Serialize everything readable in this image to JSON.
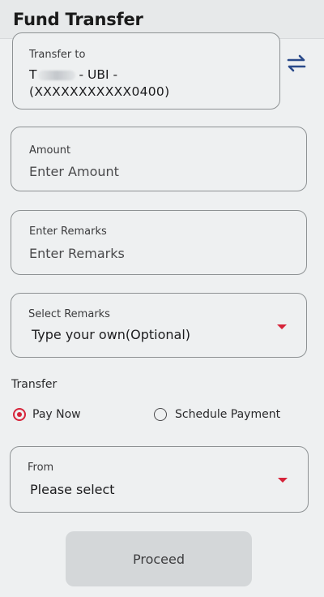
{
  "header": {
    "title": "Fund Transfer"
  },
  "transfer_to": {
    "label": "Transfer to",
    "name_initial": "T",
    "bank_suffix": "- UBI -",
    "account_masked": "(XXXXXXXXXXX0400)",
    "swap_icon": "swap-arrows-icon"
  },
  "amount": {
    "label": "Amount",
    "placeholder": "Enter Amount"
  },
  "remarks": {
    "label": "Enter Remarks",
    "placeholder": "Enter Remarks"
  },
  "select_remarks": {
    "label": "Select Remarks",
    "value": "Type your own(Optional)",
    "icon": "dropdown-arrow-icon"
  },
  "transfer_section": {
    "label": "Transfer",
    "options": [
      {
        "label": "Pay Now",
        "selected": true
      },
      {
        "label": "Schedule Payment",
        "selected": false
      }
    ]
  },
  "from": {
    "label": "From",
    "value": "Please select",
    "icon": "dropdown-arrow-icon"
  },
  "actions": {
    "proceed_label": "Proceed"
  },
  "colors": {
    "accent": "#d6243a",
    "background": "#eef0f1",
    "border": "#8e9294",
    "button_disabled": "#d4d7d9"
  }
}
